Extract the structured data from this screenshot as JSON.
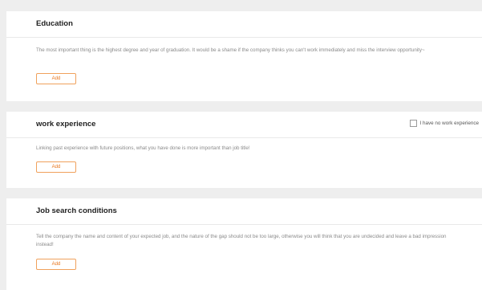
{
  "education": {
    "title": "Education",
    "description": "The most important thing is the highest degree and year of graduation. It would be a shame if the company thinks you can't work immediately and miss the interview opportunity~",
    "add_label": "Add"
  },
  "work_experience": {
    "title": "work experience",
    "no_experience_label": "I have no work experience",
    "no_experience_checked": false,
    "description": "Linking past experience with future positions, what you have done is more important than job title!",
    "add_label": "Add"
  },
  "job_search": {
    "title": "Job search conditions",
    "description": "Tell the company the name and content of your expected job, and the nature of the gap should not be too large, otherwise you will think that you are undecided and leave a bad impression instead!",
    "add_label": "Add"
  },
  "colors": {
    "accent": "#e8761d",
    "accent_border": "#f0a15c",
    "section_bg": "#ffffff",
    "page_bg": "#eeeeee"
  }
}
